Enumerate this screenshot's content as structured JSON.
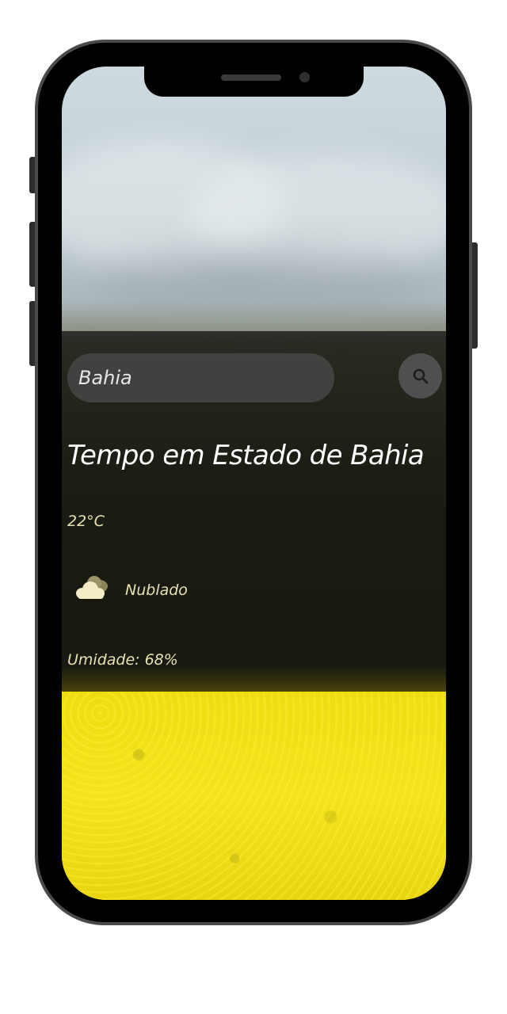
{
  "search": {
    "value": "Bahia",
    "button_icon": "search-icon"
  },
  "weather": {
    "title": "Tempo em Estado de Bahia",
    "temperature": "22°C",
    "condition_icon": "cloud-icon",
    "condition": "Nublado",
    "humidity": "Umidade: 68%"
  },
  "colors": {
    "panel_overlay": "#0a0a0a",
    "title_text": "#ffffff",
    "detail_text": "#e7e0b0",
    "search_field": "#464646",
    "search_button": "#4f4f4f",
    "phone_frame": "#000000"
  }
}
